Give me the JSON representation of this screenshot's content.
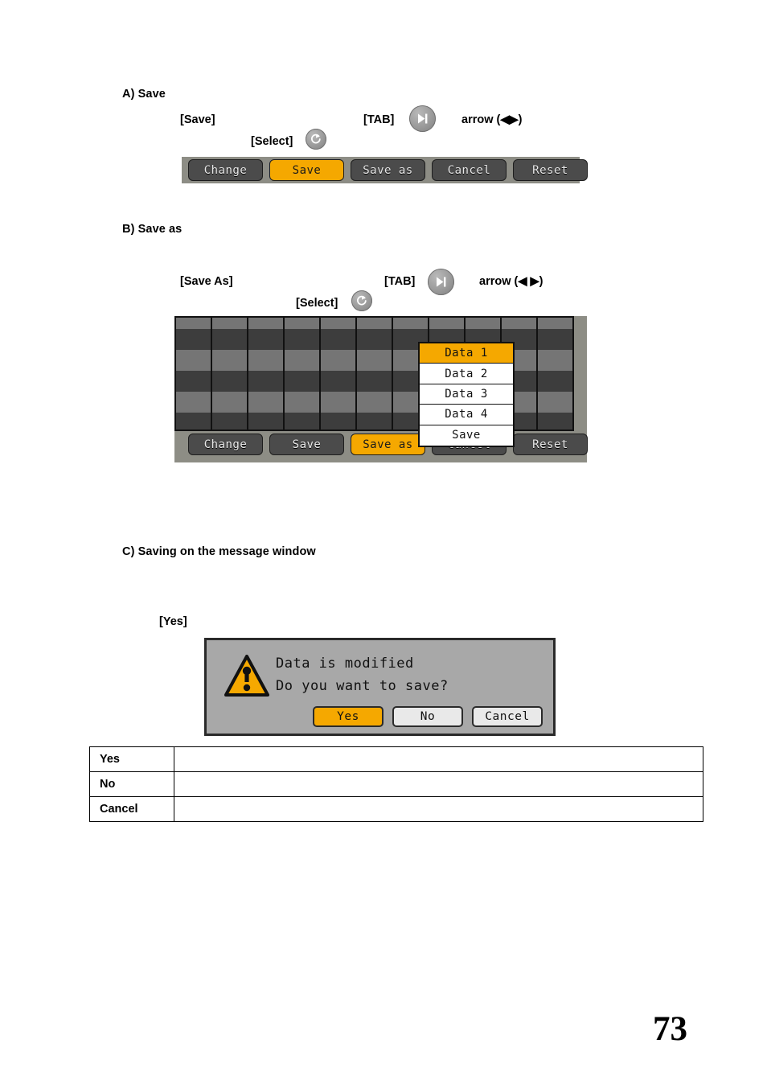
{
  "page": {
    "number": "73"
  },
  "sections": {
    "a": {
      "heading": "A) Save",
      "save_label": "[Save]",
      "tab_label": "[TAB]",
      "arrow_label": "arrow (◀▶)",
      "select_label": "[Select]",
      "buttons": [
        {
          "label": "Change",
          "selected": false
        },
        {
          "label": "Save",
          "selected": true
        },
        {
          "label": "Save as",
          "selected": false
        },
        {
          "label": "Cancel",
          "selected": false
        },
        {
          "label": "Reset",
          "selected": false
        }
      ]
    },
    "b": {
      "heading": "B) Save as",
      "save_as_label": "[Save As]",
      "tab_label": "[TAB]",
      "arrow_label": "arrow (◀ ▶)",
      "select_label": "[Select]",
      "buttons": [
        {
          "label": "Change",
          "selected": false
        },
        {
          "label": "Save",
          "selected": false
        },
        {
          "label": "Save as",
          "selected": true
        },
        {
          "label": "Cancel",
          "selected": false
        },
        {
          "label": "Reset",
          "selected": false
        }
      ],
      "dropdown": [
        {
          "label": "Data 1",
          "selected": true
        },
        {
          "label": "Data 2",
          "selected": false
        },
        {
          "label": "Data 3",
          "selected": false
        },
        {
          "label": "Data 4",
          "selected": false
        },
        {
          "label": "Save",
          "selected": false
        }
      ]
    },
    "c": {
      "heading": "C) Saving on the message window",
      "yes_label": "[Yes]",
      "dialog": {
        "line1": "Data is modified",
        "line2": "Do you want to save?",
        "icon": "warning-triangle-icon",
        "buttons": [
          {
            "label": "Yes",
            "selected": true
          },
          {
            "label": "No",
            "selected": false
          },
          {
            "label": "Cancel",
            "selected": false
          }
        ]
      },
      "table": {
        "rows": [
          {
            "key": "Yes",
            "value": ""
          },
          {
            "key": "No",
            "value": ""
          },
          {
            "key": "Cancel",
            "value": ""
          }
        ]
      }
    }
  },
  "colors": {
    "accent_orange": "#f5a800",
    "panel_gray": "#8d8d85",
    "button_dark": "#4b4b4b",
    "dialog_gray": "#a8a8a8"
  },
  "icons": {
    "tab": "skip-next-icon",
    "select": "rotary-select-icon"
  }
}
